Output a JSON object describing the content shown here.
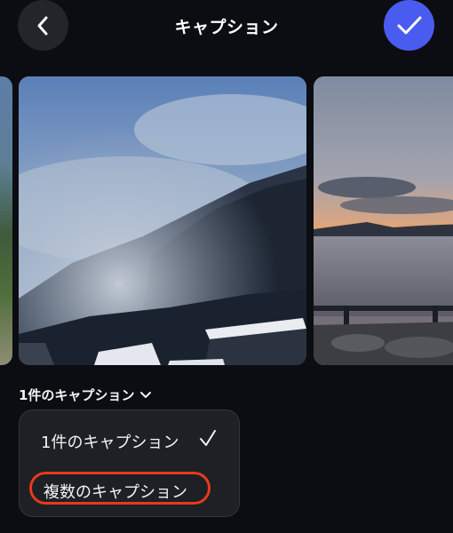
{
  "header": {
    "title": "キャプション",
    "back_icon": "chevron-left-icon",
    "confirm_icon": "checkmark-icon"
  },
  "photos": [
    {
      "name": "photo-left-partial"
    },
    {
      "name": "photo-snowy-mountain"
    },
    {
      "name": "photo-sunset-lake"
    }
  ],
  "caption_mode": {
    "current_label": "1件のキャプション",
    "toggle_icon": "chevron-down-icon",
    "options": [
      {
        "label": "1件のキャプション",
        "selected": true
      },
      {
        "label": "複数のキャプション",
        "selected": false,
        "highlighted": true
      }
    ]
  },
  "colors": {
    "accent": "#4a5cf0",
    "highlight": "#e8391d",
    "background": "#0b0d12"
  }
}
